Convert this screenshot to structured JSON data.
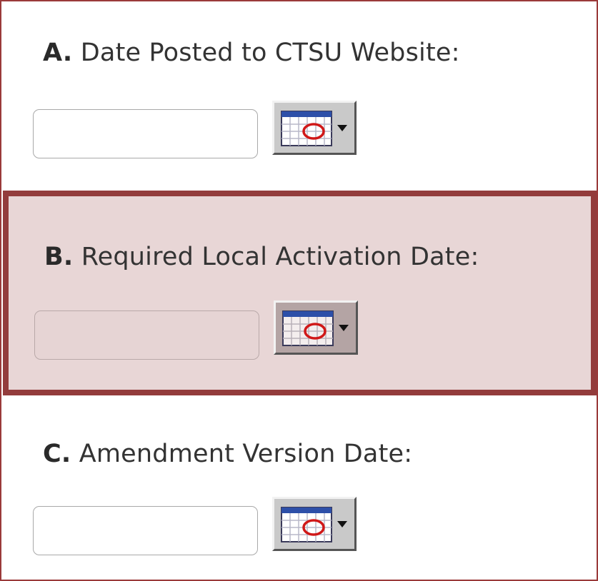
{
  "fields": [
    {
      "letter": "A.",
      "label": "Date Posted to CTSU Website:",
      "value": "",
      "calendar_icon": "calendar-icon"
    },
    {
      "letter": "B.",
      "label": "Required Local Activation Date:",
      "value": "",
      "calendar_icon": "calendar-icon",
      "highlighted": true
    },
    {
      "letter": "C.",
      "label": "Amendment Version Date:",
      "value": "",
      "calendar_icon": "calendar-icon"
    }
  ],
  "colors": {
    "frame_border": "#9a3a3a",
    "highlight_border": "#933c3c",
    "highlight_background": "#e8d6d6",
    "calendar_red_circle": "#d01818"
  }
}
